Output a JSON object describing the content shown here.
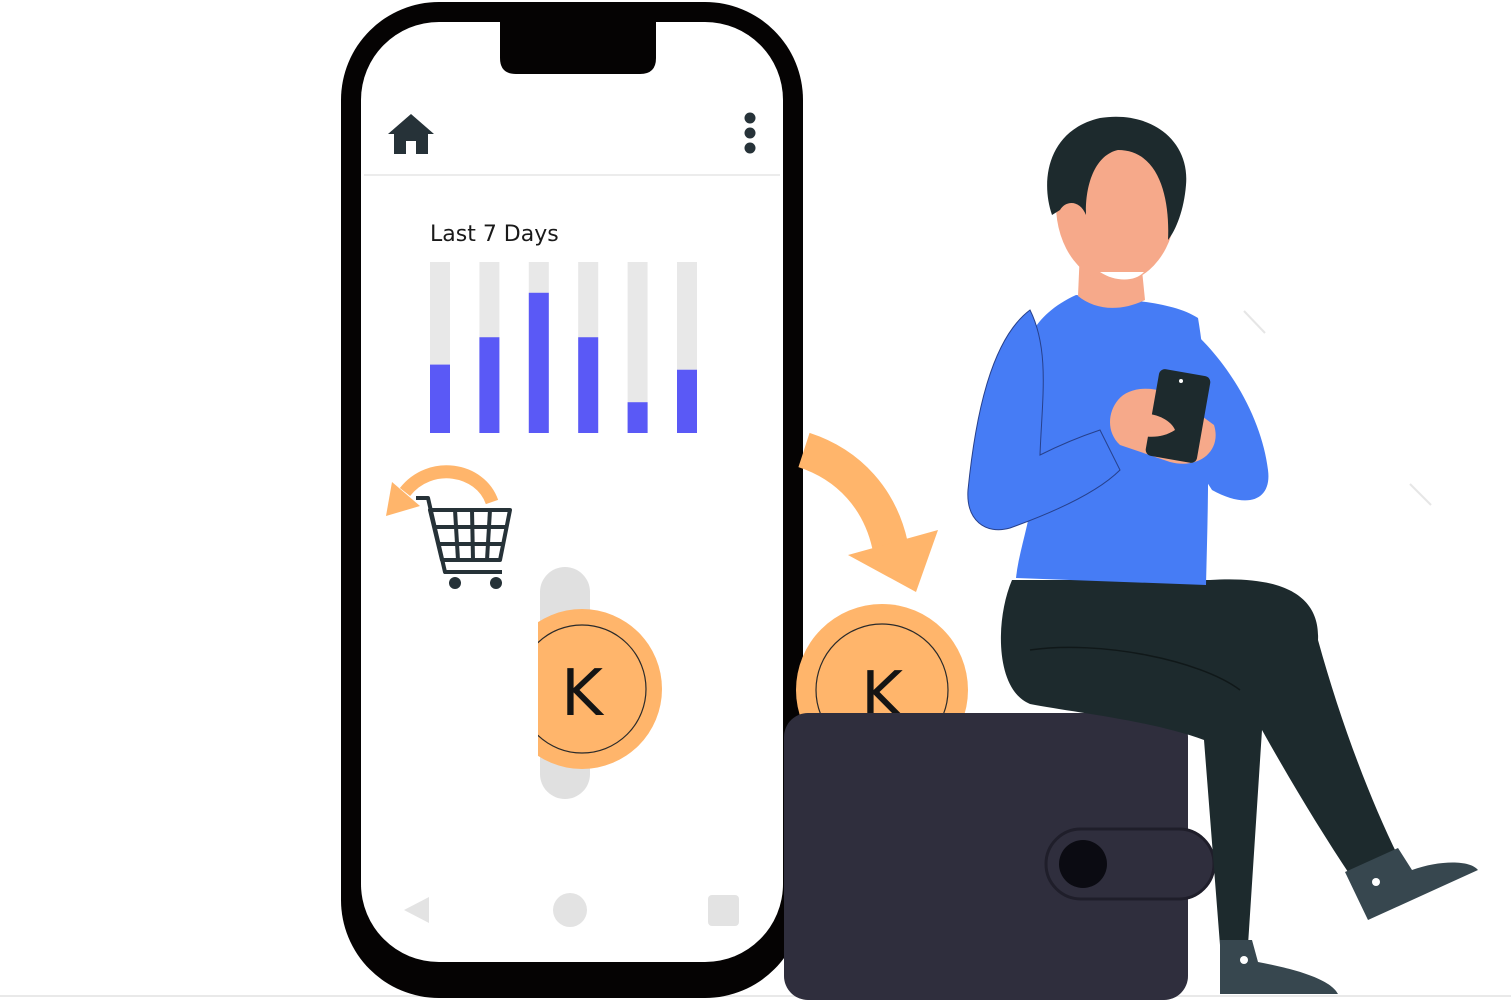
{
  "phone": {
    "toolbar": {
      "home_icon": "home-icon",
      "menu_icon": "more-vertical-icon"
    },
    "nav": {
      "back_icon": "back-triangle-icon",
      "home_icon": "home-circle-icon",
      "recents_icon": "recents-square-icon"
    }
  },
  "chart_data": {
    "type": "bar",
    "title": "Last 7 Days",
    "categories": [
      "",
      "",
      "",
      "",
      "",
      ""
    ],
    "values": [
      40,
      56,
      82,
      56,
      18,
      37
    ],
    "ylim": [
      0,
      100
    ],
    "xlabel": "",
    "ylabel": "",
    "grid": false,
    "colors": {
      "bar": "#5a59f6",
      "track": "#e8e8e8"
    }
  },
  "illustration": {
    "coin_letter": "K",
    "cart_icon": "shopping-cart-icon",
    "return_arrow_icon": "return-arrow-icon",
    "transfer_arrow_icon": "curved-arrow-icon",
    "wallet": "wallet-icon",
    "person": "person-holding-phone",
    "colors": {
      "coin": "#ffb56b",
      "sweater": "#467cf5",
      "pants": "#1d2a2d",
      "wallet": "#2f2e3d",
      "skin": "#f6a98a",
      "dark": "#263238"
    }
  }
}
